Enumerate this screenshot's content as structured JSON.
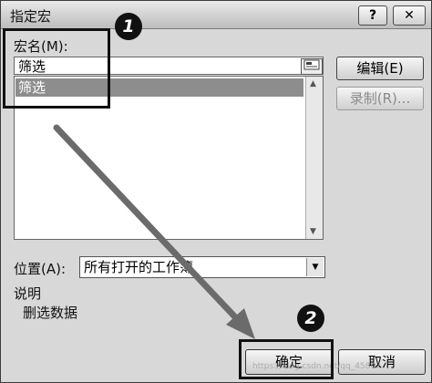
{
  "window": {
    "title": "指定宏",
    "help_label": "?",
    "close_label": "✕"
  },
  "macro_name": {
    "label": "宏名(M):",
    "value": "筛选",
    "ref_icon": "range-select-icon"
  },
  "macro_list": {
    "items": [
      "筛选"
    ]
  },
  "side_buttons": {
    "edit": "编辑(E)",
    "record": "录制(R)..."
  },
  "location": {
    "label": "位置(A):",
    "value": "所有打开的工作簿"
  },
  "description": {
    "label": "说明",
    "text": "删选数据"
  },
  "buttons": {
    "ok": "确定",
    "cancel": "取消"
  },
  "callouts": {
    "step1": "1",
    "step2": "2"
  },
  "watermark": "https://blog.csdn.net/qq_45807"
}
